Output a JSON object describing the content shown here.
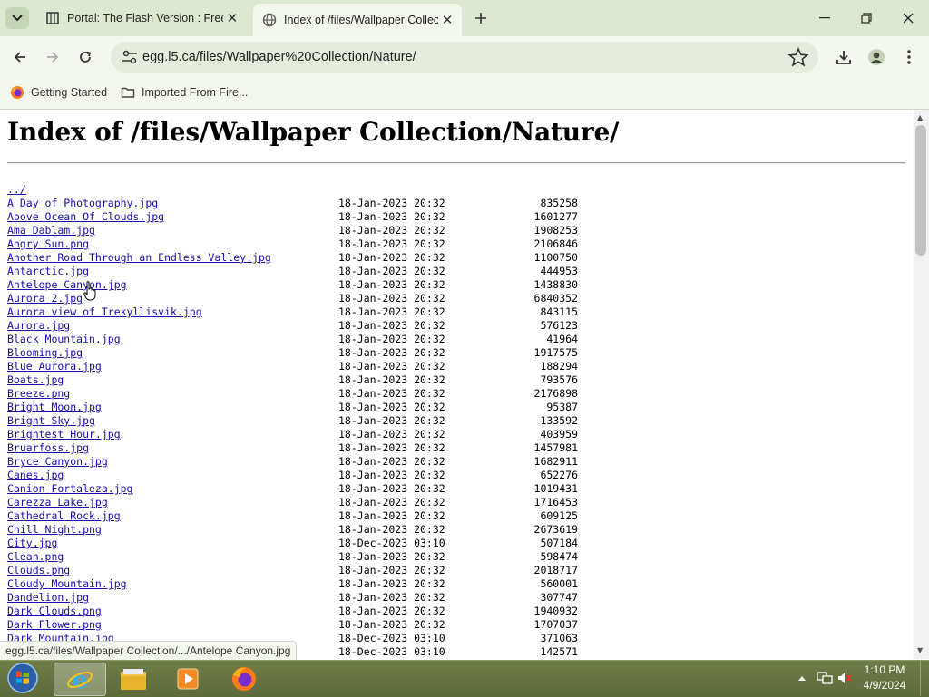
{
  "browser": {
    "tabs": [
      {
        "title": "Portal: The Flash Version : Free",
        "active": false
      },
      {
        "title": "Index of /files/Wallpaper Collec",
        "active": true
      }
    ],
    "url": "egg.l5.ca/files/Wallpaper%20Collection/Nature/",
    "bookmarks": [
      {
        "label": "Getting Started",
        "icon": "firefox-icon"
      },
      {
        "label": "Imported From Fire...",
        "icon": "folder-icon"
      }
    ],
    "status_url": "egg.l5.ca/files/Wallpaper Collection/.../Antelope Canyon.jpg"
  },
  "page": {
    "heading": "Index of /files/Wallpaper Collection/Nature/",
    "parent_link": "../",
    "entries": [
      {
        "name": "A Day of Photography.jpg",
        "date": "18-Jan-2023 20:32",
        "size": "835258"
      },
      {
        "name": "Above Ocean Of Clouds.jpg",
        "date": "18-Jan-2023 20:32",
        "size": "1601277"
      },
      {
        "name": "Ama Dablam.jpg",
        "date": "18-Jan-2023 20:32",
        "size": "1908253"
      },
      {
        "name": "Angry Sun.png",
        "date": "18-Jan-2023 20:32",
        "size": "2106846"
      },
      {
        "name": "Another Road Through an Endless Valley.jpg",
        "date": "18-Jan-2023 20:32",
        "size": "1100750"
      },
      {
        "name": "Antarctic.jpg",
        "date": "18-Jan-2023 20:32",
        "size": "444953"
      },
      {
        "name": "Antelope Canyon.jpg",
        "date": "18-Jan-2023 20:32",
        "size": "1438830"
      },
      {
        "name": "Aurora 2.jpg",
        "date": "18-Jan-2023 20:32",
        "size": "6840352"
      },
      {
        "name": "Aurora view of Trekyllisvik.jpg",
        "date": "18-Jan-2023 20:32",
        "size": "843115"
      },
      {
        "name": "Aurora.jpg",
        "date": "18-Jan-2023 20:32",
        "size": "576123"
      },
      {
        "name": "Black Mountain.jpg",
        "date": "18-Jan-2023 20:32",
        "size": "41964"
      },
      {
        "name": "Blooming.jpg",
        "date": "18-Jan-2023 20:32",
        "size": "1917575"
      },
      {
        "name": "Blue Aurora.jpg",
        "date": "18-Jan-2023 20:32",
        "size": "188294"
      },
      {
        "name": "Boats.jpg",
        "date": "18-Jan-2023 20:32",
        "size": "793576"
      },
      {
        "name": "Breeze.png",
        "date": "18-Jan-2023 20:32",
        "size": "2176898"
      },
      {
        "name": "Bright Moon.jpg",
        "date": "18-Jan-2023 20:32",
        "size": "95387"
      },
      {
        "name": "Bright Sky.jpg",
        "date": "18-Jan-2023 20:32",
        "size": "133592"
      },
      {
        "name": "Brightest Hour.jpg",
        "date": "18-Jan-2023 20:32",
        "size": "403959"
      },
      {
        "name": "Bruarfoss.jpg",
        "date": "18-Jan-2023 20:32",
        "size": "1457981"
      },
      {
        "name": "Bryce Canyon.jpg",
        "date": "18-Jan-2023 20:32",
        "size": "1682911"
      },
      {
        "name": "Canes.jpg",
        "date": "18-Jan-2023 20:32",
        "size": "652276"
      },
      {
        "name": "Canion Fortaleza.jpg",
        "date": "18-Jan-2023 20:32",
        "size": "1019431"
      },
      {
        "name": "Carezza Lake.jpg",
        "date": "18-Jan-2023 20:32",
        "size": "1716453"
      },
      {
        "name": "Cathedral Rock.jpg",
        "date": "18-Jan-2023 20:32",
        "size": "609125"
      },
      {
        "name": "Chill Night.png",
        "date": "18-Jan-2023 20:32",
        "size": "2673619"
      },
      {
        "name": "City.jpg",
        "date": "18-Dec-2023 03:10",
        "size": "507184"
      },
      {
        "name": "Clean.png",
        "date": "18-Jan-2023 20:32",
        "size": "598474"
      },
      {
        "name": "Clouds.png",
        "date": "18-Jan-2023 20:32",
        "size": "2018717"
      },
      {
        "name": "Cloudy Mountain.jpg",
        "date": "18-Jan-2023 20:32",
        "size": "560001"
      },
      {
        "name": "Dandelion.jpg",
        "date": "18-Jan-2023 20:32",
        "size": "307747"
      },
      {
        "name": "Dark Clouds.png",
        "date": "18-Jan-2023 20:32",
        "size": "1940932"
      },
      {
        "name": "Dark Flower.png",
        "date": "18-Jan-2023 20:32",
        "size": "1707037"
      },
      {
        "name": "Dark Mountain.jpg",
        "date": "18-Dec-2023 03:10",
        "size": "371063"
      },
      {
        "name": "",
        "date": "18-Dec-2023 03:10",
        "size": "142571"
      }
    ]
  },
  "taskbar": {
    "apps": [
      "ie-icon",
      "file-explorer-icon",
      "media-player-icon",
      "firefox-icon"
    ],
    "time": "1:10 PM",
    "date": "4/9/2024"
  }
}
